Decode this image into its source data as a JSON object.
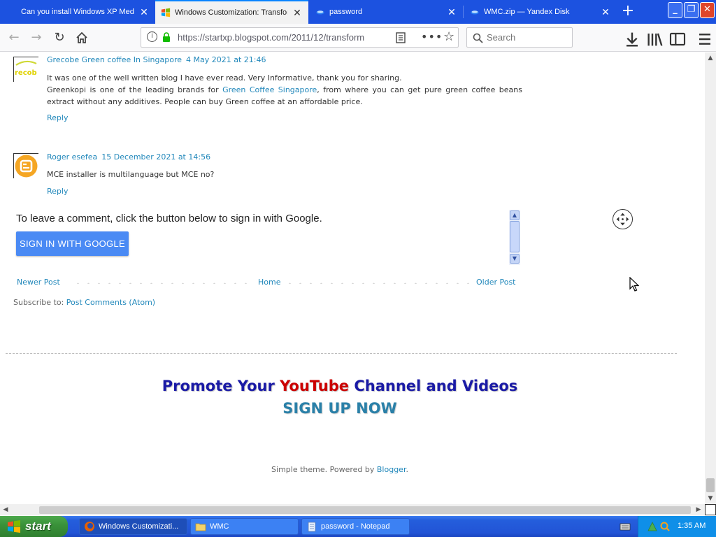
{
  "browser": {
    "tabs": [
      {
        "title": "Can you install Windows XP Media C",
        "active": false,
        "icon": "page-icon"
      },
      {
        "title": "Windows Customization: Transform",
        "active": true,
        "icon": "windows-flag-icon"
      },
      {
        "title": "password",
        "active": false,
        "icon": "yandex-disk-icon"
      },
      {
        "title": "WMC.zip — Yandex Disk",
        "active": false,
        "icon": "yandex-disk-icon"
      }
    ],
    "url": "https://startxp.blogspot.com/2011/12/transform",
    "search_placeholder": "Search"
  },
  "comments": [
    {
      "author": "Grecobe Green coffee In Singapore",
      "date": "4 May 2021 at 21:46",
      "body_1": "It was one of the well written blog I have ever read. Very Informative, thank you for sharing.",
      "body_2_pre": "Greenkopi is one of the leading brands for ",
      "body_2_link": "Green Coffee Singapore",
      "body_2_post": ", from where you can get pure green coffee beans extract without any additives. People can buy Green coffee at an affordable price.",
      "reply": "Reply"
    },
    {
      "author": "Roger esefea",
      "date": "15 December 2021 at 14:56",
      "body_1": "MCE installer is multilanguage but MCE no?",
      "reply": "Reply"
    }
  ],
  "signin": {
    "text": "To leave a comment, click the button below to sign in with Google.",
    "button": "SIGN IN WITH GOOGLE"
  },
  "pager": {
    "newer": "Newer Post",
    "home": "Home",
    "older": "Older Post"
  },
  "subscribe": {
    "label": "Subscribe to: ",
    "link": "Post Comments (Atom)"
  },
  "promo": {
    "line1_pre": "Promote Your ",
    "line1_yt": "YouTube",
    "line1_post": " Channel and Videos",
    "line2": "SIGN UP NOW"
  },
  "footer": {
    "text": "Simple theme. Powered by ",
    "link": "Blogger",
    "end": "."
  },
  "taskbar": {
    "start": "start",
    "items": [
      {
        "label": "Windows Customizati...",
        "icon": "firefox-icon",
        "active": true
      },
      {
        "label": "WMC",
        "icon": "folder-icon",
        "active": false
      },
      {
        "label": "password - Notepad",
        "icon": "notepad-icon",
        "active": false
      }
    ],
    "clock": "1:35 AM"
  },
  "colors": {
    "link": "#2288bb",
    "xp_blue": "#245edc",
    "start_green": "#3a923a",
    "promo_blue": "#1a1aa6",
    "promo_red": "#cc0000",
    "signin_button": "#4a8af4"
  }
}
